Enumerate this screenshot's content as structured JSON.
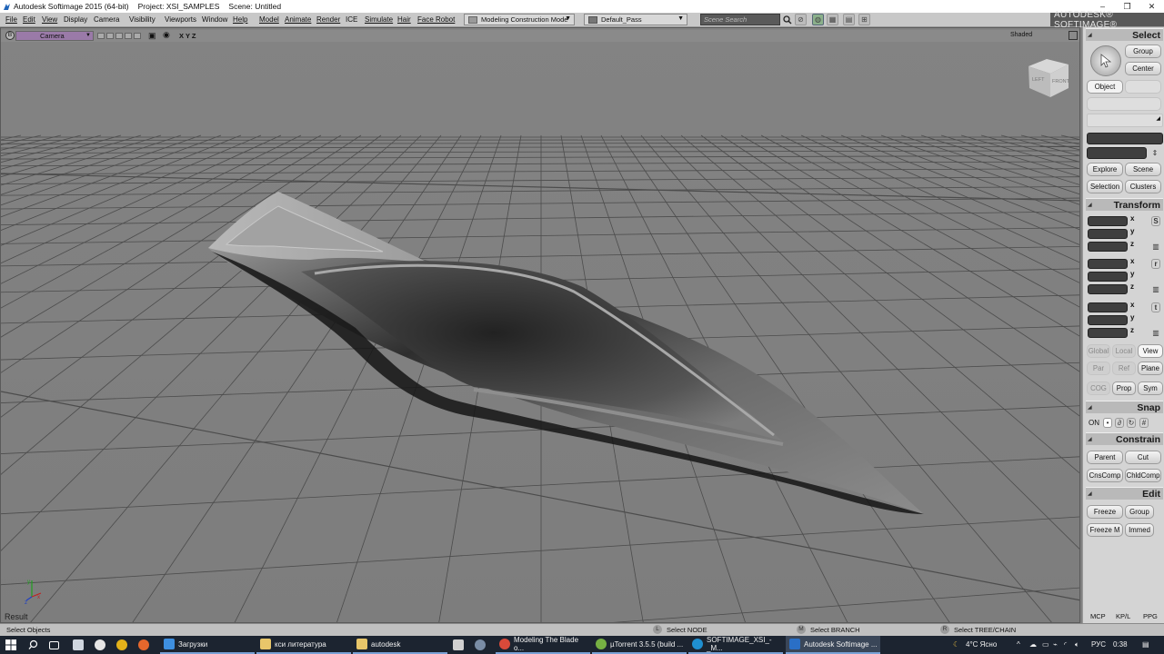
{
  "window": {
    "app_title": "Autodesk Softimage 2015 (64-bit)",
    "project": "Project: XSI_SAMPLES",
    "scene": "Scene: Untitled",
    "minimize": "‒",
    "maximize": "❐",
    "close": "✕"
  },
  "menubar": {
    "items": [
      "File",
      "Edit",
      "View",
      "Display",
      "Camera",
      "Visibility",
      "Viewports",
      "Window",
      "Help",
      "Model",
      "Animate",
      "Render",
      "ICE",
      "Simulate",
      "Hair",
      "Face Robot"
    ],
    "mode_dropdown": "Modeling Construction Mode",
    "pass_dropdown": "Default_Pass",
    "search_placeholder": "Scene Search",
    "brand": "AUTODESK® SOFTIMAGE®"
  },
  "viewport": {
    "letter": "B",
    "camera": "Camera",
    "axes": "X  Y  Z",
    "display_mode": "Shaded",
    "result_label": "Result",
    "cube_left": "LEFT",
    "cube_front": "FRONT",
    "colors": {
      "background": "#808080",
      "grid": "#4a4a4a",
      "axis_x": "#c02020",
      "axis_y": "#20a020",
      "axis_z": "#2040c0"
    }
  },
  "mcp": {
    "select": {
      "title": "Select",
      "group": "Group",
      "center": "Center",
      "object": "Object",
      "explore": "Explore",
      "scene": "Scene",
      "selection": "Selection",
      "clusters": "Clusters"
    },
    "transform": {
      "title": "Transform",
      "s": "S",
      "r": "r",
      "t": "t",
      "x": "x",
      "y": "y",
      "z": "z",
      "global": "Global",
      "local": "Local",
      "view": "View",
      "par": "Par",
      "ref": "Ref",
      "plane": "Plane",
      "cog": "COG",
      "prop": "Prop",
      "sym": "Sym"
    },
    "snap": {
      "title": "Snap",
      "on": "ON"
    },
    "constrain": {
      "title": "Constrain",
      "parent": "Parent",
      "cut": "Cut",
      "cnscomp": "CnsComp",
      "childcomp": "ChldComp"
    },
    "edit": {
      "title": "Edit",
      "freeze": "Freeze",
      "group": "Group",
      "freezem": "Freeze M",
      "immed": "Immed"
    },
    "tabs": [
      "MCP",
      "KP/L",
      "PPG"
    ]
  },
  "status": {
    "message": "Select Objects",
    "l_key": "L",
    "l_text": "Select NODE",
    "m_key": "M",
    "m_text": "Select BRANCH",
    "r_key": "R",
    "r_text": "Select TREE/CHAIN"
  },
  "taskbar": {
    "items": [
      "Загрузки",
      "кси литература",
      "autodesk",
      "Modeling The Blade o...",
      "µTorrent 3.5.5  (build ...",
      "SOFTIMAGE_XSI_-_M...",
      "Autodesk Softimage ..."
    ],
    "weather": "4°С Ясно",
    "lang": "РУС",
    "time": "0:38"
  }
}
